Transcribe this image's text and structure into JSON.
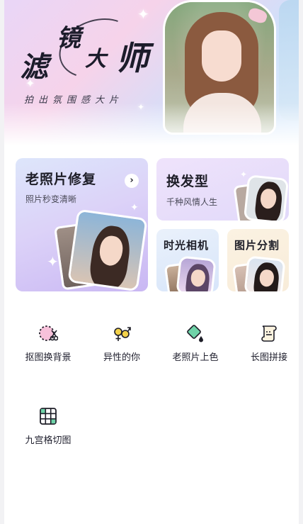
{
  "banner": {
    "title_chars": [
      "滤",
      "镜",
      "大",
      "师"
    ],
    "subtitle": "拍出氛围感大片"
  },
  "cards": {
    "old_photo": {
      "title": "老照片修复",
      "subtitle": "照片秒变清晰",
      "arrow": "›"
    },
    "hairstyle": {
      "title": "换发型",
      "subtitle": "千种风情人生"
    },
    "time_camera": {
      "title": "时光相机"
    },
    "image_split": {
      "title": "图片分割"
    }
  },
  "tools": [
    {
      "label": "抠图换背景",
      "icon": "cutout-scissors-icon"
    },
    {
      "label": "异性的你",
      "icon": "gender-swap-icon"
    },
    {
      "label": "老照片上色",
      "icon": "paint-bucket-icon"
    },
    {
      "label": "长图拼接",
      "icon": "scroll-icon"
    },
    {
      "label": "九宫格切图",
      "icon": "grid-icon"
    }
  ],
  "colors": {
    "accent_pink": "#f47fb0",
    "icon_dark": "#1e1e28",
    "icon_yellow": "#f3d24a",
    "icon_green": "#6fd3a8"
  }
}
